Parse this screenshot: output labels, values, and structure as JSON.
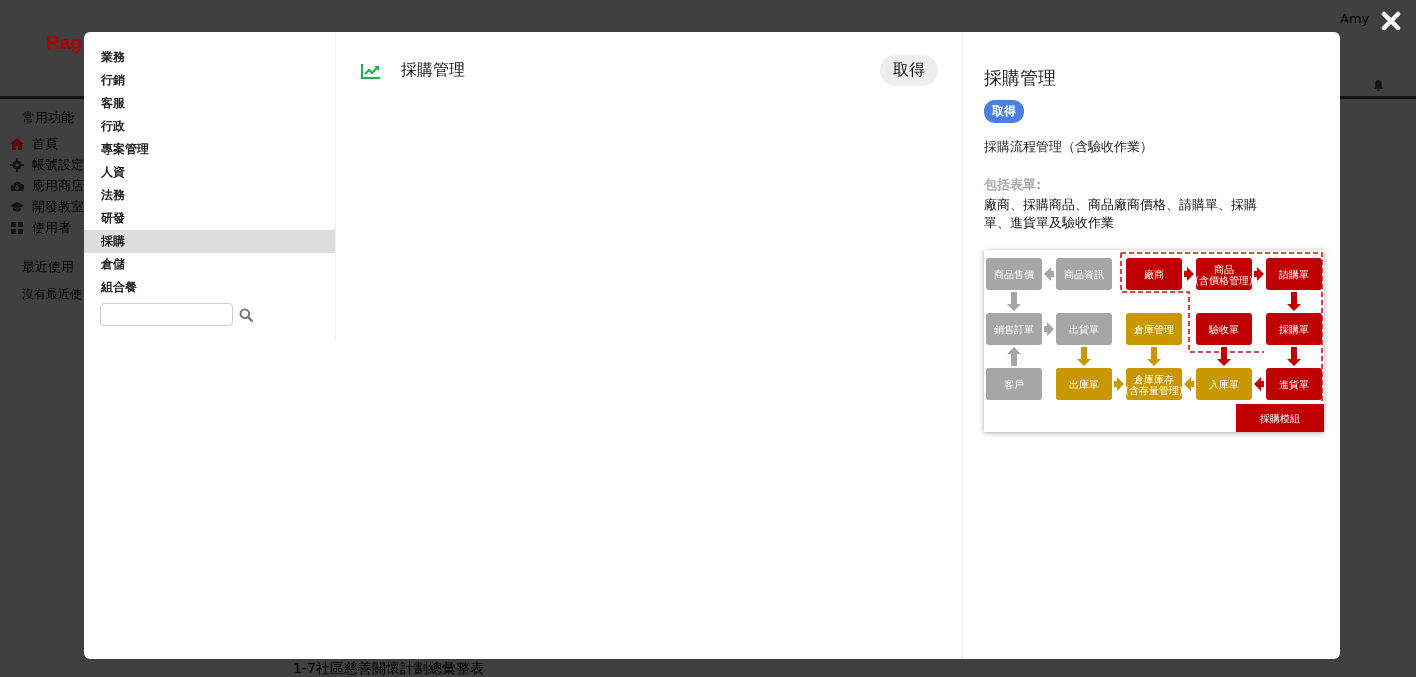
{
  "background_page": {
    "logo": "Rag",
    "user_menu": "Amy",
    "sidebar": {
      "title": "常用功能",
      "items": [
        {
          "label": "首頁",
          "kind": "home"
        },
        {
          "label": "帳號設定",
          "kind": "settings"
        },
        {
          "label": "應用商店",
          "kind": "cloud"
        },
        {
          "label": "開發教室",
          "kind": "graduation"
        },
        {
          "label": "使用者",
          "kind": "grid"
        }
      ],
      "recent_title": "最近使用",
      "recent_empty": "沒有最近使"
    },
    "bottom_link": "1-7社區慈善關懷計劃總彙整表"
  },
  "modal": {
    "categories": [
      {
        "label": "業務",
        "selected": false
      },
      {
        "label": "行銷",
        "selected": false
      },
      {
        "label": "客服",
        "selected": false
      },
      {
        "label": "行政",
        "selected": false
      },
      {
        "label": "專案管理",
        "selected": false
      },
      {
        "label": "人資",
        "selected": false
      },
      {
        "label": "法務",
        "selected": false
      },
      {
        "label": "研發",
        "selected": false
      },
      {
        "label": "採購",
        "selected": true
      },
      {
        "label": "倉儲",
        "selected": false
      },
      {
        "label": "組合餐",
        "selected": false
      }
    ],
    "apps": [
      {
        "name": "採購管理",
        "button": "取得"
      }
    ],
    "detail": {
      "title": "採購管理",
      "button": "取得",
      "description": "採購流程管理（含驗收作業）",
      "forms_label": "包括表單:",
      "forms": "廠商、採購商品、商品廠商價格、請購單、採購單、進貨單及驗收作業",
      "diagram": {
        "nodes": [
          {
            "lines": [
              "商品售價"
            ],
            "color": "#a6a6a6"
          },
          {
            "lines": [
              "商品資訊"
            ],
            "color": "#a6a6a6"
          },
          {
            "lines": [
              "廠商"
            ],
            "color": "#c00000"
          },
          {
            "lines": [
              "商品",
              "(含價格管理)"
            ],
            "color": "#c00000"
          },
          {
            "lines": [
              "請購單"
            ],
            "color": "#c00000"
          },
          {
            "lines": [
              "銷售訂單"
            ],
            "color": "#a6a6a6"
          },
          {
            "lines": [
              "出貨單"
            ],
            "color": "#a6a6a6"
          },
          {
            "lines": [
              "倉庫管理"
            ],
            "color": "#c99700"
          },
          {
            "lines": [
              "驗收單"
            ],
            "color": "#c00000"
          },
          {
            "lines": [
              "採購單"
            ],
            "color": "#c00000"
          },
          {
            "lines": [
              "客戶"
            ],
            "color": "#a6a6a6"
          },
          {
            "lines": [
              "出庫單"
            ],
            "color": "#c99700"
          },
          {
            "lines": [
              "倉庫庫存",
              "(含存量管理)"
            ],
            "color": "#c99700"
          },
          {
            "lines": [
              "入庫單"
            ],
            "color": "#c99700"
          },
          {
            "lines": [
              "進貨單"
            ],
            "color": "#c00000"
          }
        ],
        "module_label": "採購模組"
      }
    }
  }
}
